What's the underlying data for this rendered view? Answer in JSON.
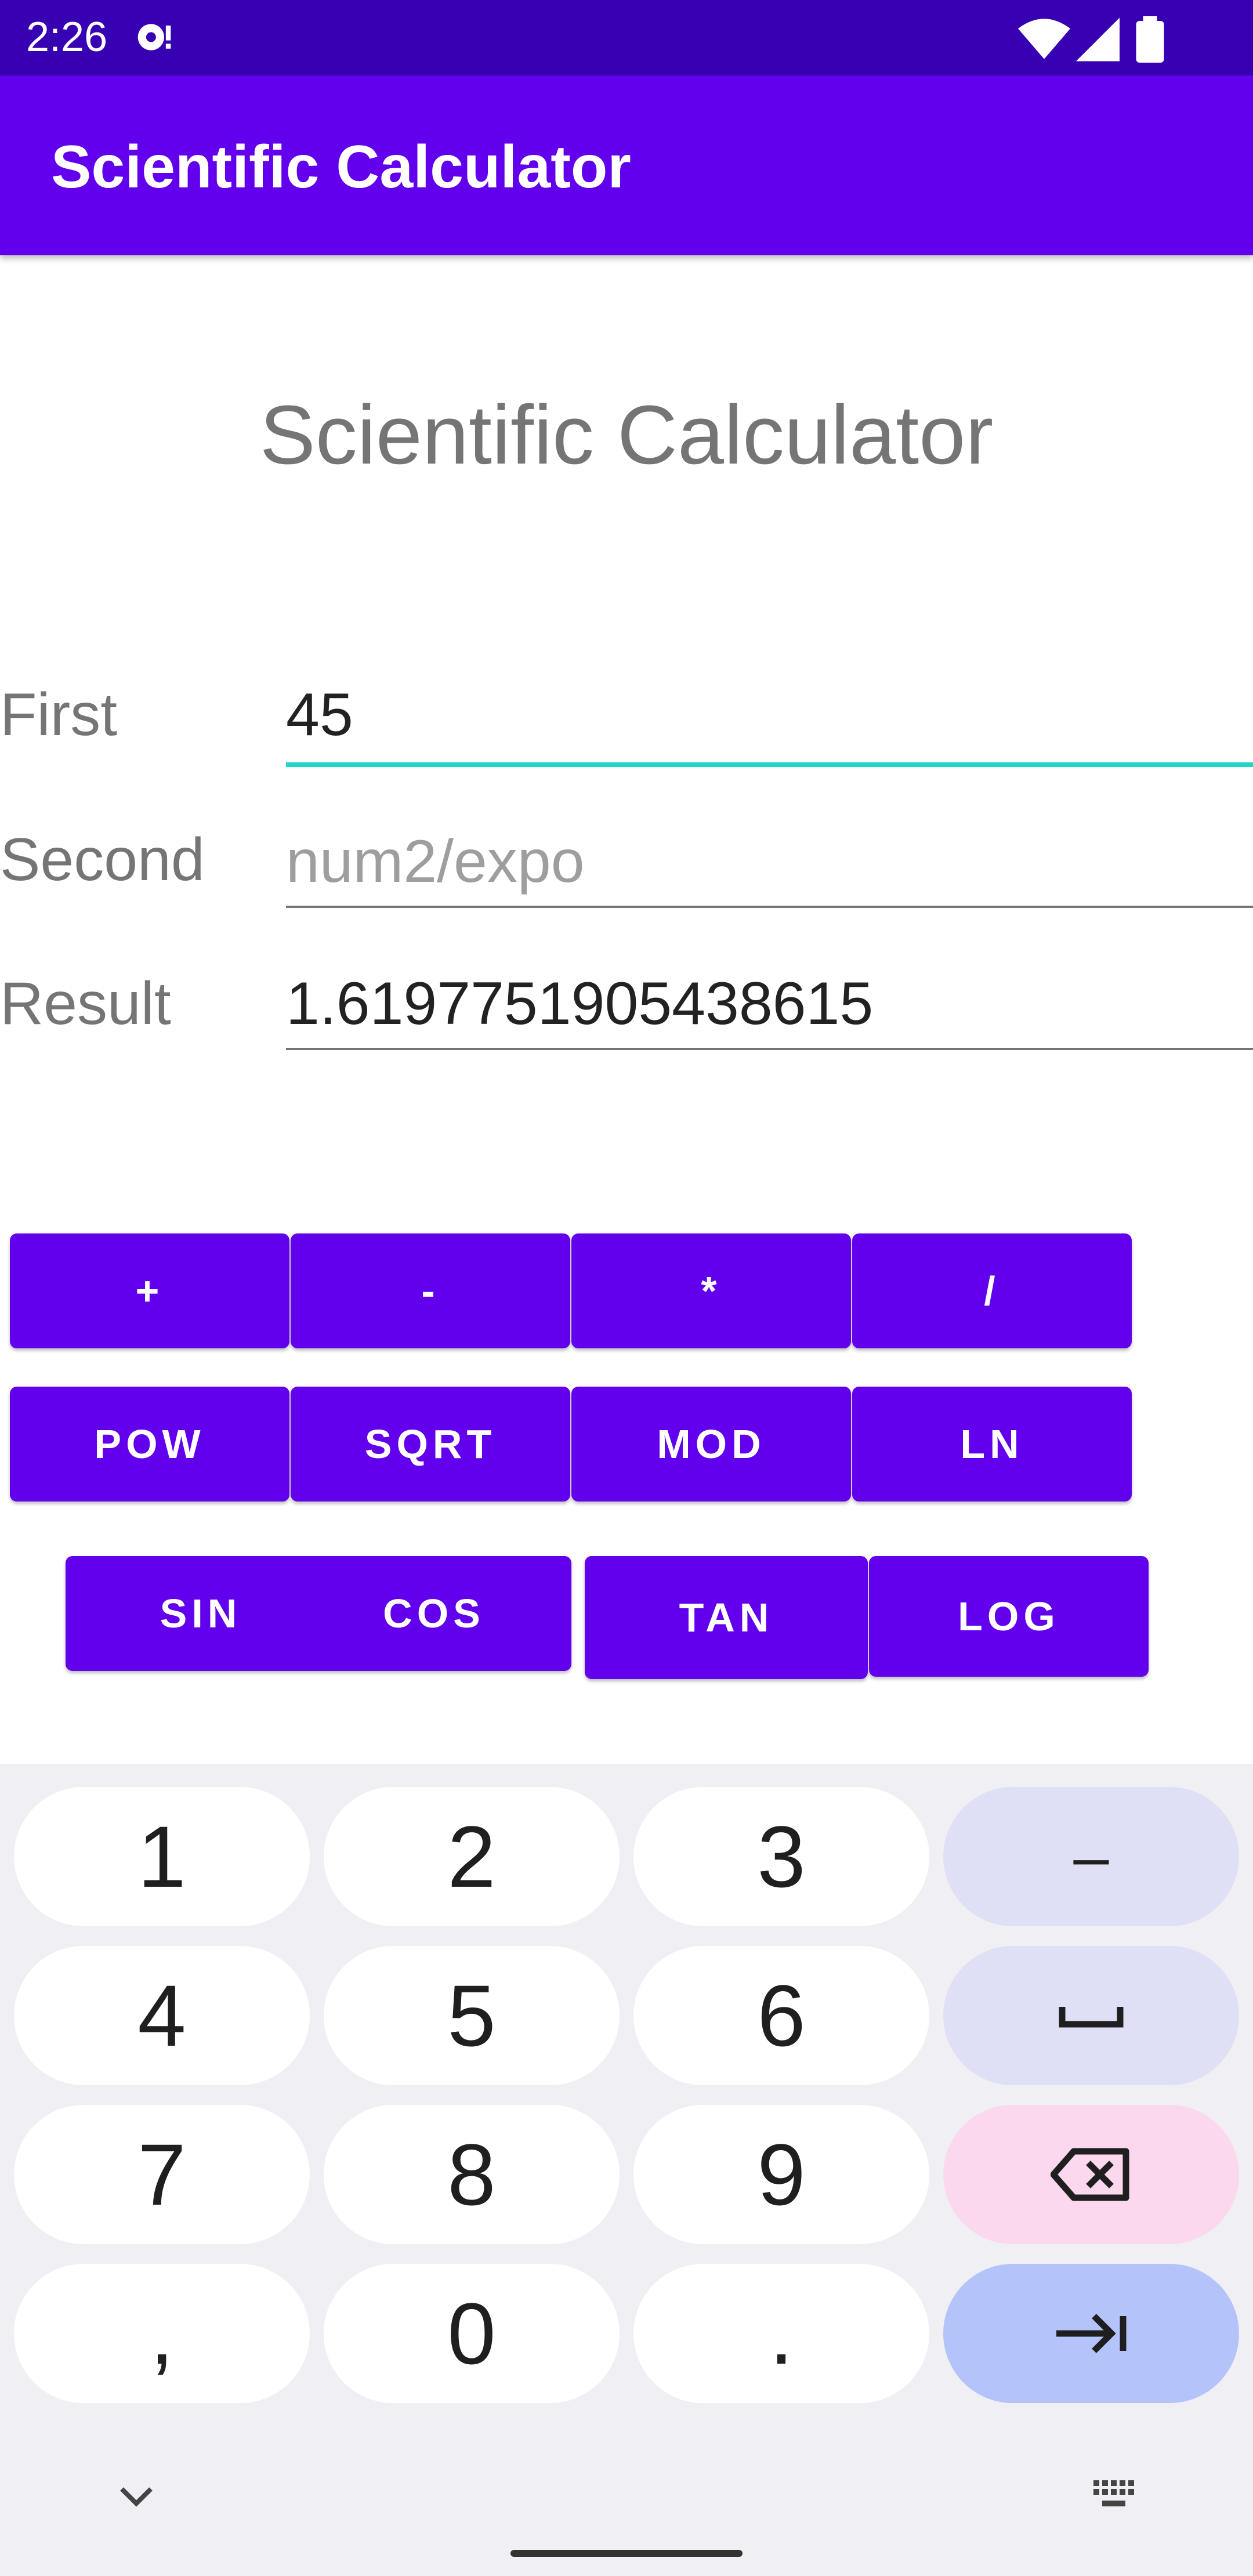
{
  "status_bar": {
    "time": "2:26",
    "icons": [
      "media-icon",
      "wifi-icon",
      "signal-icon",
      "battery-icon"
    ]
  },
  "app_bar": {
    "title": "Scientific Calculator"
  },
  "heading": "Scientific Calculator",
  "fields": {
    "first": {
      "label": "First",
      "value": "45"
    },
    "second": {
      "label": "Second",
      "placeholder": "num2/expo"
    },
    "result": {
      "label": "Result",
      "value": "1.6197751905438615"
    }
  },
  "buttons": {
    "row1": [
      "+",
      "-",
      "*",
      "/"
    ],
    "row2": [
      "POW",
      "SQRT",
      "MOD",
      "LN"
    ],
    "row3": [
      "SIN",
      "COS",
      "TAN",
      "LOG"
    ]
  },
  "keyboard": {
    "rows": [
      [
        "1",
        "2",
        "3",
        "–"
      ],
      [
        "4",
        "5",
        "6",
        "space-icon"
      ],
      [
        "7",
        "8",
        "9",
        "backspace-icon"
      ],
      [
        ",",
        "0",
        ".",
        "tab-icon"
      ]
    ],
    "bottom_icons": [
      "chevron-down-icon",
      "keyboard-icon"
    ]
  },
  "colors": {
    "status_bar": "#3700b3",
    "primary": "#6200ee",
    "accent_underline": "#1ed7c4"
  }
}
